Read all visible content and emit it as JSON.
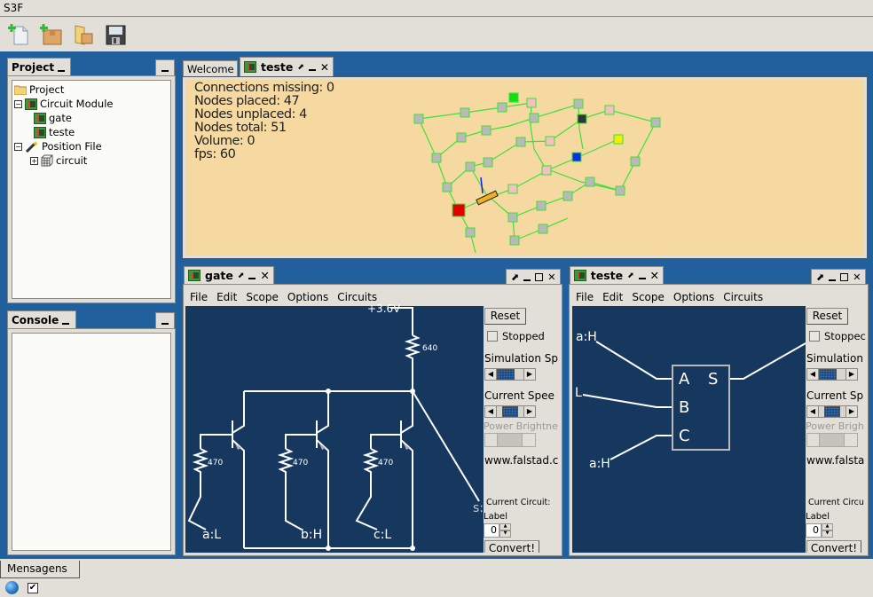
{
  "app": {
    "title": "S3F"
  },
  "toolbar": {
    "buttons": [
      {
        "name": "new-file",
        "icon": "new-file-icon"
      },
      {
        "name": "new-module",
        "icon": "new-package-icon"
      },
      {
        "name": "open",
        "icon": "open-folder-icon"
      },
      {
        "name": "save",
        "icon": "floppy-disk-icon"
      }
    ]
  },
  "project_panel": {
    "title": "Project",
    "tree": [
      {
        "label": "Project",
        "icon": "folder-icon",
        "level": 0
      },
      {
        "label": "Circuit Module",
        "icon": "circuit-module-icon",
        "level": 1,
        "expanded": true
      },
      {
        "label": "gate",
        "icon": "circuit-module-icon",
        "level": 2
      },
      {
        "label": "teste",
        "icon": "circuit-module-icon",
        "level": 2
      },
      {
        "label": "Position File",
        "icon": "magic-wand-icon",
        "level": 1,
        "expanded": true
      },
      {
        "label": "circuit",
        "icon": "grid-cube-icon",
        "level": 2,
        "expanded": false
      }
    ]
  },
  "console_panel": {
    "title": "Console"
  },
  "main_tabs": [
    {
      "label": "Welcome",
      "active": false
    },
    {
      "label": "teste",
      "active": true
    }
  ],
  "viewer_stats": {
    "connections_missing": "Connections missing: 0",
    "nodes_placed": "Nodes placed: 47",
    "nodes_unplaced": "Nodes unplaced: 4",
    "nodes_total": "Nodes total: 51",
    "volume": "Volume: 0",
    "fps": "fps: 60"
  },
  "colors": {
    "viewer_bg": "#f5d9a0",
    "circuit_bg": "#17385e",
    "desktop_bg": "#21609c",
    "grid_green": "#3de03d"
  },
  "gate_window": {
    "title": "gate",
    "menu": [
      "File",
      "Edit",
      "Scope",
      "Options",
      "Circuits"
    ],
    "circuit": {
      "supply_label": "+3.6V",
      "r_top": "640",
      "r_bases": [
        "470",
        "470",
        "470"
      ],
      "inputs": [
        "a:L",
        "b:H",
        "c:L"
      ],
      "output": "s:"
    },
    "side": {
      "reset": "Reset",
      "stopped": "Stopped",
      "sim_speed": "Simulation Sp",
      "current_speed": "Current Spee",
      "power_brightness": "Power Brightne",
      "url": "www.falstad.c",
      "current_circuit": "Current Circuit:",
      "label": "Label",
      "label_value": "0",
      "convert": "Convert!"
    }
  },
  "teste_window": {
    "title": "teste",
    "menu": [
      "File",
      "Edit",
      "Scope",
      "Options",
      "Circuits"
    ],
    "circuit": {
      "inputs": [
        "a:H",
        "L",
        "a:H"
      ],
      "pins": [
        "A",
        "B",
        "C",
        "S"
      ]
    },
    "side": {
      "reset": "Reset",
      "stopped": "Stoppec",
      "sim_speed": "Simulation",
      "current_speed": "Current Sp",
      "power_brightness": "Power Brigh",
      "url": "www.falsta",
      "current_circuit": "Current Circu",
      "label": "Label",
      "label_value": "0",
      "convert": "Convert!"
    }
  },
  "bottom": {
    "tab": "Mensagens"
  }
}
